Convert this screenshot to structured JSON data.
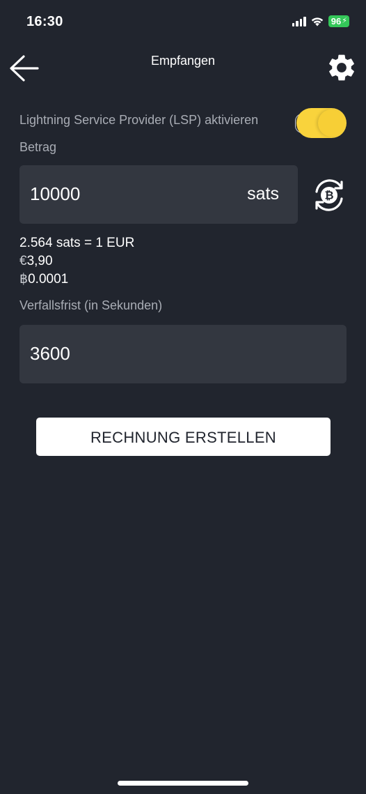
{
  "status_bar": {
    "time": "16:30",
    "battery": "96",
    "icons": [
      "signal-icon",
      "wifi-icon",
      "battery-charging-icon"
    ]
  },
  "header": {
    "title": "Empfangen",
    "back_icon": "arrow-left-icon",
    "settings_icon": "gear-icon"
  },
  "lsp": {
    "label": "Lightning Service Provider (LSP) aktivieren",
    "enabled": true
  },
  "amount": {
    "label": "Betrag",
    "value": "10000",
    "unit": "sats",
    "switch_icon": "bitcoin-refresh-icon"
  },
  "conversion": {
    "rate": "2.564 sats = 1 EUR",
    "eur_symbol": "€",
    "eur_value": "3,90",
    "btc_symbol": "฿",
    "btc_value": "0.0001"
  },
  "expiry": {
    "label": "Verfallsfrist (in Sekunden)",
    "value": "3600"
  },
  "actions": {
    "create_invoice": "RECHNUNG ERSTELLEN"
  },
  "colors": {
    "background": "#21252e",
    "field": "#333740",
    "accent": "#f9d33c",
    "label": "#a9adb5"
  }
}
